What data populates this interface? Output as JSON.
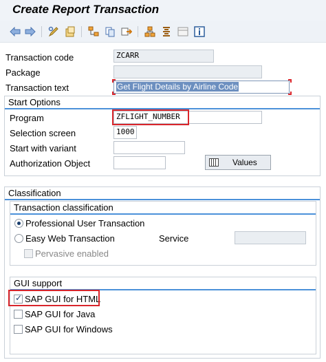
{
  "title": "Create Report Transaction",
  "toolbar": {
    "icons": [
      "back-arrow-icon",
      "forward-arrow-icon",
      "display-change-icon",
      "other-object-icon",
      "where-used-icon",
      "copy-icon",
      "transport-icon",
      "hierarchy-icon",
      "align-icon",
      "layout-icon",
      "info-icon"
    ]
  },
  "fields": {
    "transaction_code_label": "Transaction code",
    "transaction_code_value": "ZCARR",
    "package_label": "Package",
    "package_value": "",
    "transaction_text_label": "Transaction text",
    "transaction_text_value": "Get Flight Details by Airline Code"
  },
  "start_options": {
    "title": "Start Options",
    "program_label": "Program",
    "program_value": "ZFLIGHT_NUMBER",
    "selection_screen_label": "Selection screen",
    "selection_screen_value": "1000",
    "variant_label": "Start with variant",
    "variant_value": "",
    "auth_label": "Authorization Object",
    "auth_value": "",
    "values_button": "Values"
  },
  "classification": {
    "title": "Classification",
    "transaction_classification": {
      "title": "Transaction classification",
      "professional": "Professional User Transaction",
      "professional_selected": true,
      "easy_web": "Easy Web Transaction",
      "service_label": "Service",
      "service_value": "",
      "pervasive": "Pervasive enabled"
    },
    "gui_support": {
      "title": "GUI support",
      "html": "SAP GUI for HTML",
      "html_checked": true,
      "java": "SAP GUI for Java",
      "windows": "SAP GUI for Windows"
    }
  },
  "colors": {
    "highlight": "#d9252b",
    "group_accent": "#4a90d9"
  }
}
